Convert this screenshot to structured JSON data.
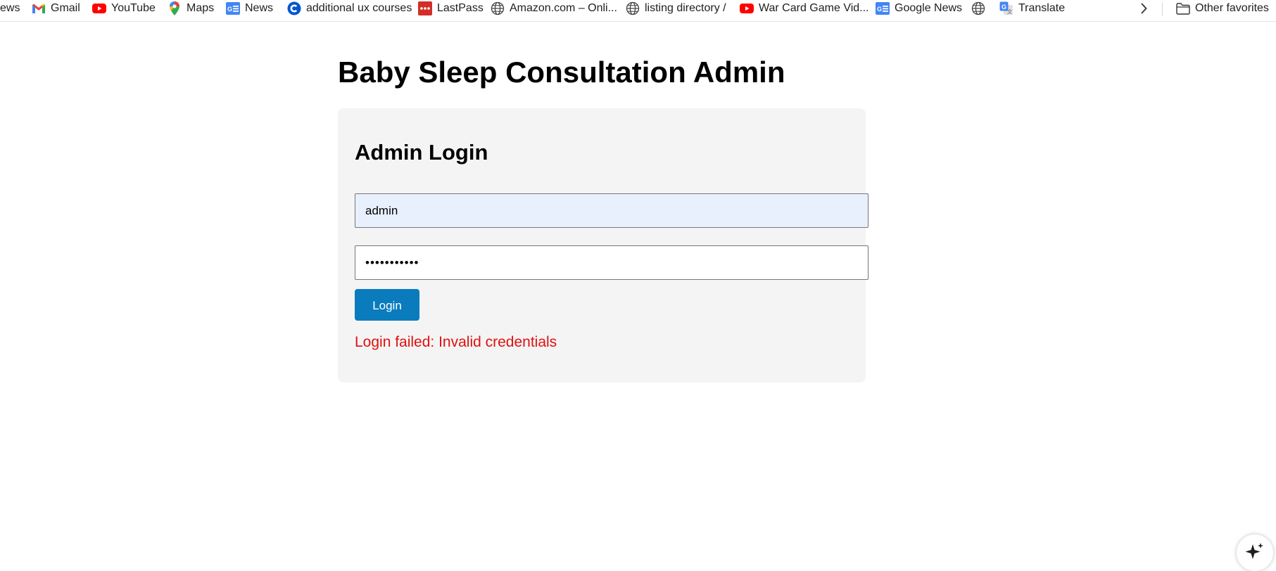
{
  "bookmarks": {
    "items": [
      {
        "label": "ews",
        "icon": "none"
      },
      {
        "label": "Gmail",
        "icon": "gmail-icon"
      },
      {
        "label": "YouTube",
        "icon": "youtube-icon"
      },
      {
        "label": "Maps",
        "icon": "maps-icon"
      },
      {
        "label": "News",
        "icon": "google-news-icon"
      },
      {
        "label": "additional ux courses",
        "icon": "coursera-icon"
      },
      {
        "label": "LastPass",
        "icon": "lastpass-icon"
      },
      {
        "label": "Amazon.com – Onli...",
        "icon": "globe-icon"
      },
      {
        "label": "listing directory /",
        "icon": "globe-icon"
      },
      {
        "label": "War Card Game Vid...",
        "icon": "youtube-icon"
      },
      {
        "label": "Google News",
        "icon": "google-news-icon"
      },
      {
        "label": "",
        "icon": "globe-icon"
      },
      {
        "label": "Translate",
        "icon": "translate-icon"
      }
    ],
    "other_favorites": "Other favorites"
  },
  "page": {
    "title": "Baby Sleep Consultation Admin"
  },
  "login": {
    "heading": "Admin Login",
    "username_value": "admin",
    "password_value": "•••••••••••",
    "button_label": "Login",
    "error": "Login failed: Invalid credentials"
  },
  "colors": {
    "button": "#0a7bbd",
    "error": "#e0100f",
    "card_background": "#f4f4f4",
    "autofill_background": "#e8f0fe"
  }
}
